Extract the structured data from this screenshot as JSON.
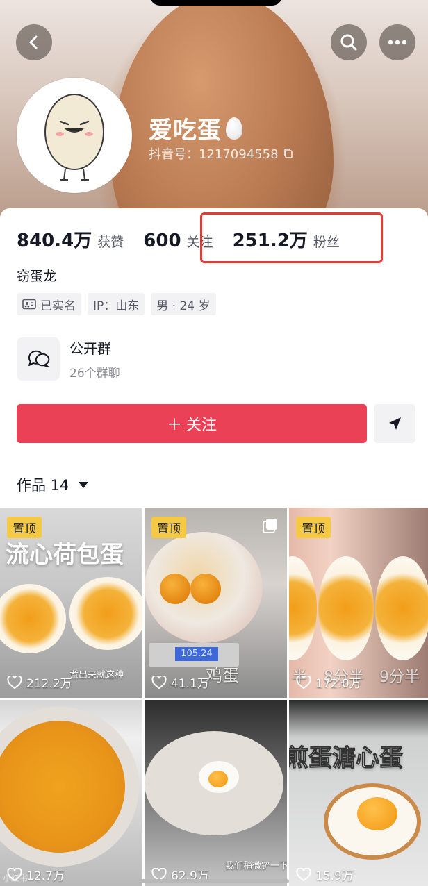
{
  "profile": {
    "nickname": "爱吃蛋",
    "douyin_id": "抖音号：1217094558",
    "bio": "窃蛋龙",
    "tags": [
      {
        "icon": "id-card-icon",
        "label": "已实名"
      },
      {
        "label": "IP：山东"
      },
      {
        "label": "男 · 24 岁"
      }
    ]
  },
  "stats": {
    "likes_value": "840.4万",
    "likes_label": "获赞",
    "following_value": "600",
    "following_label": "关注",
    "followers_value": "251.2万",
    "followers_label": "粉丝"
  },
  "group": {
    "title": "公开群",
    "subtitle": "26个群聊"
  },
  "actions": {
    "follow_label": "关注",
    "follow_prefix": "＋"
  },
  "works": {
    "tab_label": "作品 14"
  },
  "videos": [
    {
      "pinned": "置顶",
      "title": "流心荷包蛋",
      "caption": "煮出来就这种",
      "likes": "212.2万"
    },
    {
      "pinned": "置顶",
      "caption": "鸡蛋",
      "scale_reading": "105.24",
      "likes": "41.1万",
      "multi": true
    },
    {
      "pinned": "置顶",
      "captions": [
        "半",
        "8分半",
        "9分半"
      ],
      "likes": "172.0万"
    },
    {
      "likes": "12.7万"
    },
    {
      "caption": "我们稍微铲一下",
      "likes": "62.9万"
    },
    {
      "title": "煎蛋溏心蛋",
      "likes": "15.9万"
    }
  ],
  "watermark": "小红书",
  "colors": {
    "follow_button": "#ea4156",
    "highlight_border": "#e23b34",
    "pin_badge": "#f6c945"
  }
}
